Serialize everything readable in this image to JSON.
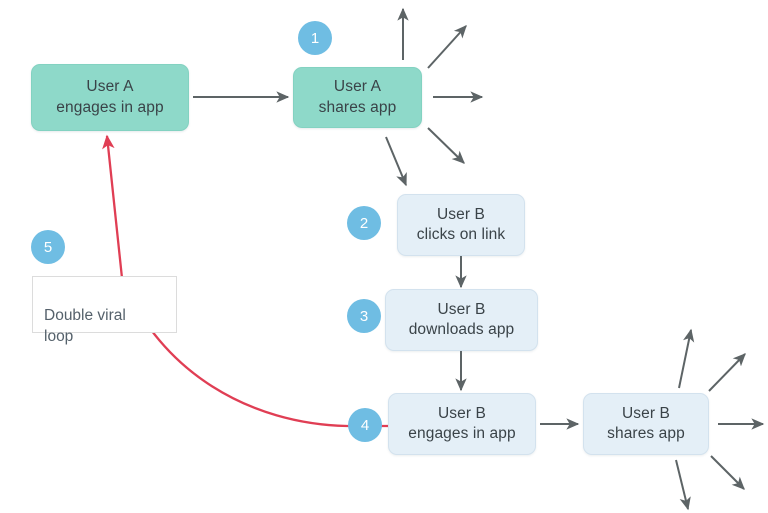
{
  "diagram": {
    "title": "Double viral loop",
    "colors": {
      "teal_fill": "#8ed9c9",
      "teal_border": "#83d2c1",
      "blue_fill": "#e4eff7",
      "blue_border": "#d3e2ee",
      "badge_blue": "#6fbde3",
      "arrow_gray": "#5d6466",
      "loop_red": "#e03e54",
      "text_dark": "#3a4348",
      "callout_text": "#55616b",
      "background": "#ffffff"
    },
    "nodes": [
      {
        "id": "user-a-engages",
        "label": "User A\nengages in app",
        "style": "teal"
      },
      {
        "id": "user-a-shares",
        "label": "User A\nshares app",
        "style": "teal"
      },
      {
        "id": "user-b-clicks",
        "label": "User B\nclicks on link",
        "style": "blue"
      },
      {
        "id": "user-b-downloads",
        "label": "User B\ndownloads app",
        "style": "blue"
      },
      {
        "id": "user-b-engages",
        "label": "User B\nengages in app",
        "style": "blue"
      },
      {
        "id": "user-b-shares",
        "label": "User B\nshares app",
        "style": "blue"
      }
    ],
    "badges": [
      {
        "id": "badge-1",
        "value": "1",
        "attached_to": "user-a-shares"
      },
      {
        "id": "badge-2",
        "value": "2",
        "attached_to": "user-b-clicks"
      },
      {
        "id": "badge-3",
        "value": "3",
        "attached_to": "user-b-downloads"
      },
      {
        "id": "badge-4",
        "value": "4",
        "attached_to": "user-b-engages"
      },
      {
        "id": "badge-5",
        "value": "5",
        "attached_to": "double-viral-loop-callout"
      }
    ],
    "callout": {
      "id": "double-viral-loop-callout",
      "text": "Double viral\nloop"
    }
  }
}
